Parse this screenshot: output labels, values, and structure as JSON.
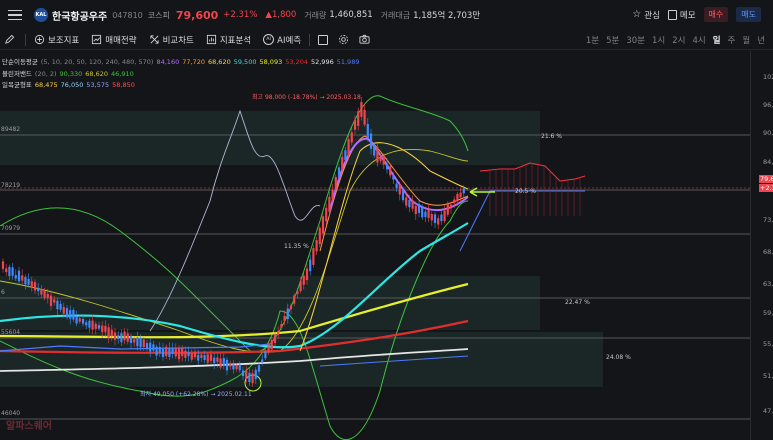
{
  "header": {
    "logo_text": "KAL",
    "stock_name": "한국항공우주",
    "code": "047810",
    "market": "코스피",
    "price": "79,600",
    "change_pct": "+2.31%",
    "change_abs": "▲1,800",
    "volume_label": "거래량",
    "volume": "1,460,851",
    "amount_label": "거래대금",
    "amount": "1,185억 2,703만",
    "watch_label": "관심",
    "memo_label": "메모",
    "buy_label": "매수",
    "sell_label": "매도"
  },
  "toolbar": {
    "items": [
      "보조지표",
      "매매전략",
      "비교차트",
      "지표분석",
      "AI예측"
    ],
    "timeframes": [
      "1분",
      "5분",
      "30분",
      "1시",
      "2시",
      "4시",
      "일",
      "주",
      "월",
      "년"
    ],
    "active_timeframe": "일"
  },
  "legend": {
    "ma_label": "단순이동평균",
    "ma_params": "(5, 10, 20, 50, 120, 240, 480, 570)",
    "ma_values": [
      "84,160",
      "77,720",
      "68,620",
      "59,500",
      "58,093",
      "53,204",
      "52,996",
      "51,989"
    ],
    "ma_colors": [
      "#b36cff",
      "#ff9a3c",
      "#ffd23f",
      "#2ee6e6",
      "#e6ef2e",
      "#e02e2e",
      "#e6e6e6",
      "#4d7bff"
    ],
    "bb_label": "볼린저밴드",
    "bb_params": "(20, 2)",
    "bb_values": [
      "90,330",
      "68,620",
      "46,910"
    ],
    "bb_colors": [
      "#3ec23e",
      "#c8c82a",
      "#3ec23e"
    ],
    "ichimoku_label": "일목균형표",
    "ichimoku_values": [
      "68,475",
      "76,050",
      "53,575",
      "58,850"
    ],
    "ichimoku_colors": [
      "#ffd23f",
      "#8fd8ff",
      "#9aa3ff",
      "#ff5050"
    ]
  },
  "annotations": {
    "high": "최고 98,000 (-18.78%) → 2025.03.18",
    "low": "최저 49,050 (+62.28%) → 2025.02.11",
    "pct_1135": "11.35 %",
    "pct_216": "21.6 %",
    "pct_205": "20.5 %",
    "pct_2247": "22.47 %",
    "pct_2408": "24.08 %",
    "watermark": "알파스퀘어"
  },
  "left_levels": [
    "89482",
    "78219",
    "70979",
    "6",
    "55604",
    "46040"
  ],
  "price_axis": {
    "ticks": [
      "102",
      "96,0",
      "90,0",
      "84,0",
      "78,0",
      "73,0",
      "68,0",
      "63,0",
      "59,0",
      "55,0",
      "51,0",
      "47,0"
    ],
    "current_price": "79,6",
    "current_change": "+2.3"
  },
  "colors": {
    "up": "#f0444e",
    "down": "#3d8bff",
    "accent": "#f0444e"
  }
}
